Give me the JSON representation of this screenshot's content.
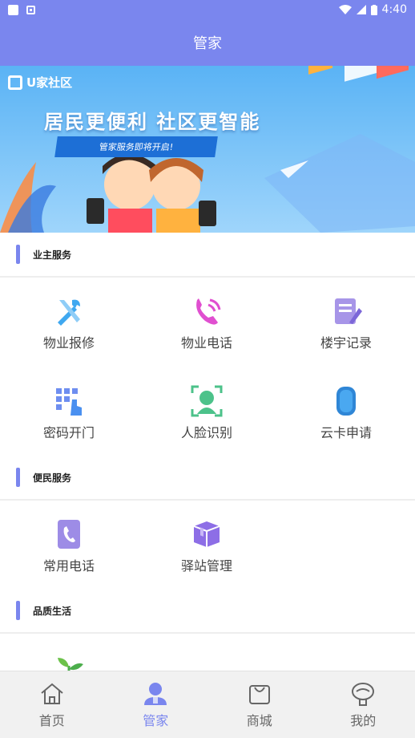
{
  "status": {
    "time": "4:40"
  },
  "header": {
    "title": "管家"
  },
  "banner": {
    "logo_text": "U家社区",
    "headline": "居民更便利 社区更智能",
    "ribbon": "管家服务即将开启!"
  },
  "sections": {
    "owner": {
      "title": "业主服务",
      "items": [
        {
          "label": "物业报修",
          "icon": "wrench-screwdriver-icon"
        },
        {
          "label": "物业电话",
          "icon": "phone-icon"
        },
        {
          "label": "楼宇记录",
          "icon": "notepad-icon"
        },
        {
          "label": "密码开门",
          "icon": "keypad-icon"
        },
        {
          "label": "人脸识别",
          "icon": "face-scan-icon"
        },
        {
          "label": "云卡申请",
          "icon": "cloud-card-icon"
        }
      ]
    },
    "convenience": {
      "title": "便民服务",
      "items": [
        {
          "label": "常用电话",
          "icon": "phone-book-icon"
        },
        {
          "label": "驿站管理",
          "icon": "package-icon"
        }
      ]
    },
    "quality": {
      "title": "品质生活",
      "items": [
        {
          "label": "",
          "icon": "sprout-icon"
        }
      ]
    }
  },
  "tabs": [
    {
      "label": "首页",
      "icon": "home-icon",
      "active": false
    },
    {
      "label": "管家",
      "icon": "butler-icon",
      "active": true
    },
    {
      "label": "商城",
      "icon": "shopping-bag-icon",
      "active": false
    },
    {
      "label": "我的",
      "icon": "profile-icon",
      "active": false
    }
  ],
  "colors": {
    "accent": "#7a86ee",
    "tab_inactive": "#666666"
  }
}
